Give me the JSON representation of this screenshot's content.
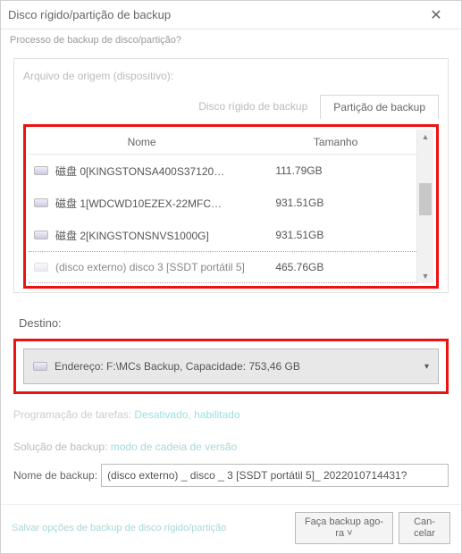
{
  "titlebar": {
    "title": "Disco rígido/partição de backup"
  },
  "subtitle": "Processo de backup de disco/partição?",
  "source": {
    "label": "Arquivo de origem (dispositivo):",
    "tabs": {
      "hdd": "Disco rígido de backup",
      "partition": "Partição de backup"
    },
    "columns": {
      "name": "Nome",
      "size": "Tamanho"
    },
    "rows": [
      {
        "name": "磁盘 0[KINGSTONSA400S37120…",
        "size": "111.79GB"
      },
      {
        "name": "磁盘 1[WDCWD10EZEX-22MFC…",
        "size": "931.51GB"
      },
      {
        "name": "磁盘 2[KINGSTONSNVS1000G]",
        "size": "931.51GB"
      },
      {
        "name": "(disco externo) disco 3 [SSDT portátil 5]",
        "size": "465.76GB"
      }
    ]
  },
  "dest": {
    "label": "Destino:",
    "value": "Endereço: F:\\MCs Backup, Capacidade: 753,46 GB"
  },
  "schedule": {
    "prefix": "Programação de tarefas: ",
    "link1": "Desativado",
    "sep": ", ",
    "link2": "habilitado"
  },
  "solution": {
    "prefix": "Solução de backup: ",
    "link": "modo de cadeia de versão"
  },
  "backupName": {
    "label": "Nome de backup:",
    "value": "(disco externo) _ disco _ 3 [SSDT portátil 5]_ 2022010714431?"
  },
  "footer": {
    "save": "Salvar opções de backup de disco rígido/partição",
    "go": "Faça backup ago-\nra ˅",
    "cancel": "Can-\ncelar"
  }
}
